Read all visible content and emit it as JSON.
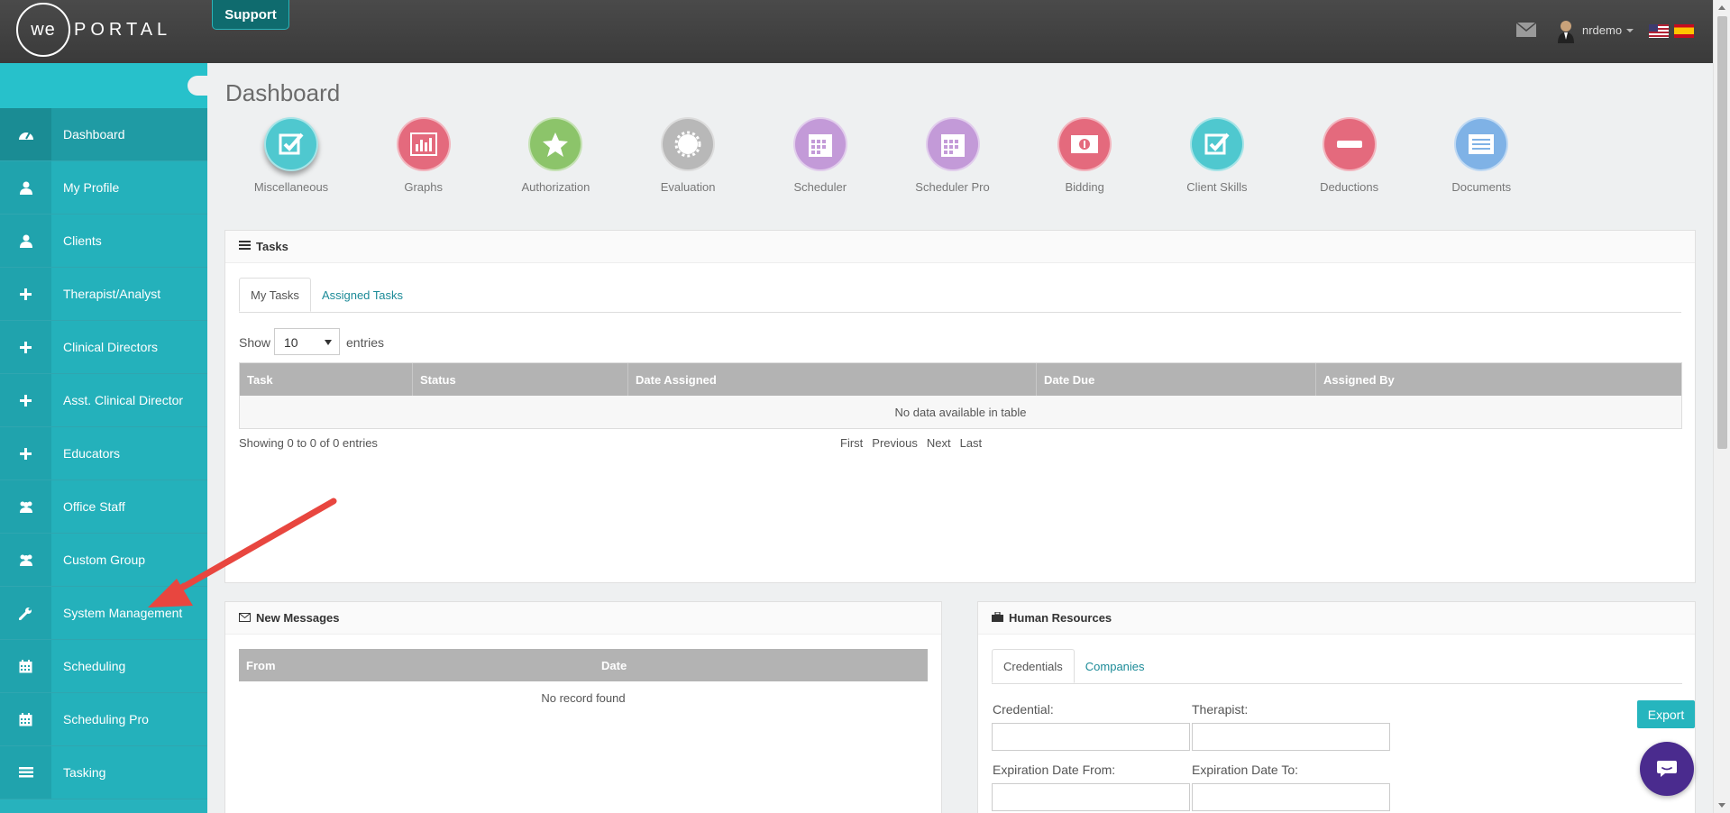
{
  "topbar": {
    "logo_we": "we",
    "logo_portal": "PORTAL",
    "support_label": "Support",
    "user_name": "nrdemo"
  },
  "sidebar": {
    "items": [
      {
        "label": "Dashboard",
        "icon": "dashboard-icon"
      },
      {
        "label": "My Profile",
        "icon": "user-icon"
      },
      {
        "label": "Clients",
        "icon": "user-icon"
      },
      {
        "label": "Therapist/Analyst",
        "icon": "plus-icon"
      },
      {
        "label": "Clinical Directors",
        "icon": "plus-icon"
      },
      {
        "label": "Asst. Clinical Director",
        "icon": "plus-icon"
      },
      {
        "label": "Educators",
        "icon": "plus-icon"
      },
      {
        "label": "Office Staff",
        "icon": "users-icon"
      },
      {
        "label": "Custom Group",
        "icon": "users-icon"
      },
      {
        "label": "System Management",
        "icon": "wrench-icon"
      },
      {
        "label": "Scheduling",
        "icon": "calendar-icon"
      },
      {
        "label": "Scheduling Pro",
        "icon": "calendar-icon"
      },
      {
        "label": "Tasking",
        "icon": "list-icon"
      }
    ]
  },
  "main": {
    "title": "Dashboard",
    "quick_icons": [
      {
        "label": "Miscellaneous",
        "color": "#4fc8cf"
      },
      {
        "label": "Graphs",
        "color": "#e46a7d"
      },
      {
        "label": "Authorization",
        "color": "#8cc46a"
      },
      {
        "label": "Evaluation",
        "color": "#b8b8b8"
      },
      {
        "label": "Scheduler",
        "color": "#c39ad8"
      },
      {
        "label": "Scheduler Pro",
        "color": "#c39ad8"
      },
      {
        "label": "Bidding",
        "color": "#e46a7d"
      },
      {
        "label": "Client Skills",
        "color": "#4fc8cf"
      },
      {
        "label": "Deductions",
        "color": "#e46a7d"
      },
      {
        "label": "Documents",
        "color": "#7fb2e6"
      }
    ]
  },
  "tasks": {
    "title": "Tasks",
    "tabs": [
      "My Tasks",
      "Assigned Tasks"
    ],
    "show_label": "Show",
    "entries_value": "10",
    "entries_label": "entries",
    "columns": [
      "Task",
      "Status",
      "Date Assigned",
      "Date Due",
      "Assigned By"
    ],
    "empty_text": "No data available in table",
    "info_text": "Showing 0 to 0 of 0 entries",
    "pager": [
      "First",
      "Previous",
      "Next",
      "Last"
    ]
  },
  "messages": {
    "title": "New Messages",
    "columns": [
      "From",
      "Date"
    ],
    "empty_text": "No record found"
  },
  "hr": {
    "title": "Human Resources",
    "tabs": [
      "Credentials",
      "Companies"
    ],
    "credential_label": "Credential:",
    "therapist_label": "Therapist:",
    "exp_from_label": "Expiration Date From:",
    "exp_to_label": "Expiration Date To:",
    "export_label": "Export"
  }
}
